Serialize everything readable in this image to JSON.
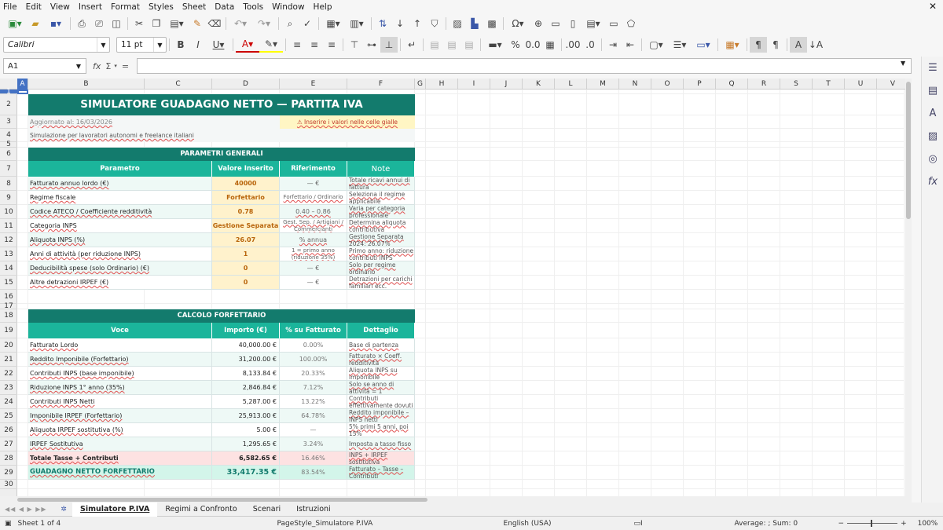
{
  "menu": [
    "File",
    "Edit",
    "View",
    "Insert",
    "Format",
    "Styles",
    "Sheet",
    "Data",
    "Tools",
    "Window",
    "Help"
  ],
  "toolbar": {
    "font_name": "Calibri",
    "font_size": "11 pt"
  },
  "formula_bar": {
    "cell_ref": "A1",
    "fx": "fx",
    "sigma": "Σ",
    "equals": "=",
    "content": ""
  },
  "columns": [
    "A",
    "B",
    "C",
    "D",
    "E",
    "F",
    "G",
    "H",
    "I",
    "J",
    "K",
    "L",
    "M",
    "N",
    "O",
    "P",
    "Q",
    "R",
    "S",
    "T",
    "U",
    "V"
  ],
  "rows": [
    "1",
    "2",
    "3",
    "4",
    "5",
    "6",
    "7",
    "8",
    "9",
    "10",
    "11",
    "12",
    "13",
    "14",
    "15",
    "16",
    "17",
    "18",
    "19",
    "20",
    "21",
    "22",
    "23",
    "24",
    "25",
    "26",
    "27",
    "28",
    "29",
    "30"
  ],
  "sheet": {
    "title": "SIMULATORE GUADAGNO NETTO — PARTITA IVA",
    "updated": "Aggiornato al: 16/03/2026",
    "hint": "⚠ Inserire i valori nelle celle gialle",
    "subtitle": "Simulazione per lavoratori autonomi e freelance italiani",
    "params_header": "PARAMETRI GENERALI",
    "params_cols": [
      "Parametro",
      "Valore Inserito",
      "Riferimento",
      "Note"
    ],
    "params": [
      {
        "label": "Fatturato annuo lordo (€)",
        "value": "40000",
        "ref": "— €",
        "note": "Totale ricavi annui di fattura"
      },
      {
        "label": "Regime fiscale",
        "value": "Forfettario",
        "ref": "Forfettario / Ordinario",
        "note": "Seleziona il regime applicabile"
      },
      {
        "label": "Codice ATECO / Coefficiente redditività",
        "value": "0.78",
        "ref": "0.40 – 0.86",
        "note": "Varia per categoria professionale"
      },
      {
        "label": "Categoria INPS",
        "value": "Gestione Separata",
        "ref": "Gest. Sep. / Artigiani / Commercianti",
        "note": "Determina aliquota contributiva"
      },
      {
        "label": "Aliquota INPS (%)",
        "value": "26.07",
        "ref": "% annua",
        "note": "Gestione Separata 2024: 26.07%"
      },
      {
        "label": "Anni di attività (per riduzione INPS)",
        "value": "1",
        "ref": "1 = primo anno (riduzione 35%)",
        "note": "Primo anno: riduzione contributi INPS"
      },
      {
        "label": "Deducibilità spese (solo Ordinario) (€)",
        "value": "0",
        "ref": "— €",
        "note": "Solo per regime ordinario"
      },
      {
        "label": "Altre detrazioni IRPEF (€)",
        "value": "0",
        "ref": "— €",
        "note": "Detrazioni per carichi familiari ecc."
      }
    ],
    "calc_header": "CALCOLO FORFETTARIO",
    "calc_cols": [
      "Voce",
      "Importo (€)",
      "% su Fatturato",
      "Dettaglio"
    ],
    "calc": [
      {
        "label": "Fatturato Lordo",
        "amount": "40,000.00 €",
        "pct": "0.00%",
        "detail": "Base di partenza"
      },
      {
        "label": "Reddito Imponibile (Forfettario)",
        "amount": "31,200.00 €",
        "pct": "100.00%",
        "detail": "Fatturato × Coeff. redditività"
      },
      {
        "label": "Contributi INPS (base imponibile)",
        "amount": "8,133.84 €",
        "pct": "20.33%",
        "detail": "Aliquota INPS su imponibile"
      },
      {
        "label": "Riduzione INPS 1° anno (35%)",
        "amount": "2,846.84 €",
        "pct": "7.12%",
        "detail": "Solo se anno di attività = 1"
      },
      {
        "label": "Contributi INPS Netti",
        "amount": "5,287.00 €",
        "pct": "13.22%",
        "detail": "Contributi effettivamente dovuti"
      },
      {
        "label": "Imponibile IRPEF (Forfettario)",
        "amount": "25,913.00 €",
        "pct": "64.78%",
        "detail": "Reddito imponibile – INPS netti"
      },
      {
        "label": "Aliquota IRPEF sostitutiva (%)",
        "amount": "5.00 €",
        "pct": "—",
        "detail": "5% primi 5 anni, poi 15%"
      },
      {
        "label": "IRPEF Sostitutiva",
        "amount": "1,295.65 €",
        "pct": "3.24%",
        "detail": "Imposta a tasso fisso"
      },
      {
        "label": "Totale Tasse + Contributi",
        "amount": "6,582.65 €",
        "pct": "16.46%",
        "detail": "INPS + IRPEF sostitutiva"
      },
      {
        "label": "GUADAGNO NETTO FORFETTARIO",
        "amount": "33,417.35 €",
        "pct": "83.54%",
        "detail": "Fatturato – Tasse – Contributi"
      }
    ]
  },
  "tabs": [
    "Simulatore P.IVA",
    "Regimi a Confronto",
    "Scenari",
    "Istruzioni"
  ],
  "status": {
    "sheet": "Sheet 1 of 4",
    "page_style": "PageStyle_Simulatore P.IVA",
    "language": "English (USA)",
    "summary": "Average: ; Sum: 0",
    "zoom": "100%"
  },
  "colors": {
    "header_dark": "#137b6d",
    "header_light": "#1bb59b",
    "input_fill": "#fff2cc",
    "total_fill": "#fde2e2",
    "net_fill": "#d3f5ea",
    "selection": "#4472c4"
  }
}
